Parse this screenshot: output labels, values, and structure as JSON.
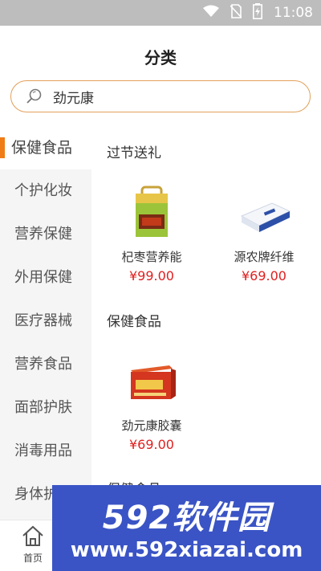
{
  "status_bar": {
    "time": "11:08",
    "icons": [
      "wifi-icon",
      "no-sim-icon",
      "battery-charging-icon"
    ]
  },
  "header": {
    "title": "分类"
  },
  "search": {
    "value": "劲元康"
  },
  "sidebar": {
    "items": [
      {
        "label": "保健食品",
        "active": true
      },
      {
        "label": "个护化妆",
        "active": false
      },
      {
        "label": "营养保健",
        "active": false
      },
      {
        "label": "外用保健",
        "active": false
      },
      {
        "label": "医疗器械",
        "active": false
      },
      {
        "label": "营养食品",
        "active": false
      },
      {
        "label": "面部护肤",
        "active": false
      },
      {
        "label": "消毒用品",
        "active": false
      },
      {
        "label": "身体护",
        "active": false
      }
    ]
  },
  "main": {
    "sections": [
      {
        "title": "过节送礼",
        "products": [
          {
            "name": "杞枣营养能",
            "price": "¥99.00"
          },
          {
            "name": "源农牌纤维",
            "price": "¥69.00"
          }
        ]
      },
      {
        "title": "保健食品",
        "products": [
          {
            "name": "劲元康胶囊",
            "price": "¥69.00"
          }
        ]
      },
      {
        "title": "保健食品",
        "products": []
      }
    ]
  },
  "bottom_nav": {
    "home_label": "首页"
  },
  "watermark": {
    "logo": "592软件园",
    "url": "www.592xiazai.com"
  },
  "colors": {
    "accent": "#f07c16",
    "price": "#e02020",
    "search_border": "#e2a05a",
    "watermark_bg": "#3a54c5"
  }
}
